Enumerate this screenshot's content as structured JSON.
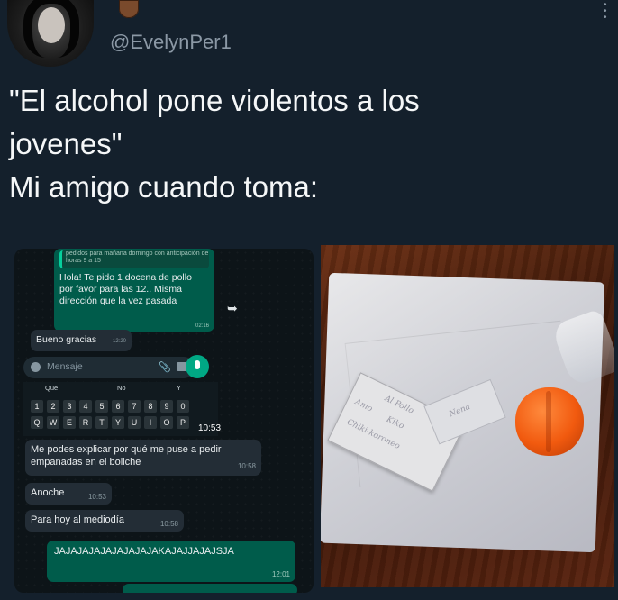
{
  "tweet": {
    "handle": "@EvelynPer1",
    "text_lines": [
      "\"El alcohol pone violentos a los",
      "jovenes\"",
      "Mi amigo cuando toma:"
    ]
  },
  "whatsapp": {
    "quoted_text": "pedidos para mañana domingo con anticipación de horas 9 a 15",
    "msg1_text": "Hola! Te pido 1 docena de pollo por favor para las 12.. Misma dirección que la vez pasada",
    "msg1_time": "02:16",
    "msg2_text": "Bueno gracias",
    "msg2_time": "12:20",
    "input_placeholder": "Mensaje",
    "keyboard_suggestions": [
      "Que",
      "No",
      "Y"
    ],
    "keyboard_keys": [
      "1",
      "2",
      "3",
      "4",
      "5",
      "6",
      "7",
      "8",
      "9",
      "0"
    ],
    "keyboard_letters": [
      "Q",
      "W",
      "E",
      "R",
      "T",
      "Y",
      "U",
      "I",
      "O",
      "P"
    ],
    "clock": "10:53",
    "chat": [
      {
        "text": "Me podes explicar por qué me puse a pedir empanadas en el boliche",
        "time": "10:58"
      },
      {
        "text": "Anoche",
        "time": "10:53"
      },
      {
        "text": "Para hoy al mediodía",
        "time": "10:58"
      }
    ],
    "reply_text": "JAJAJAJAJAJAJAJAJAKAJAJJAJAJSJA",
    "reply_time": "12:01"
  },
  "photo": {
    "card_lines": [
      "Al Pollo",
      "Amo",
      "Kiko",
      "Chiki-koroneo"
    ],
    "tag_text": "Nena"
  },
  "colors": {
    "background": "#14202c",
    "wa_outgoing": "#005c4b",
    "wa_incoming": "#232d36",
    "wa_accent": "#00a884"
  },
  "icons": [
    "more-icon",
    "share-icon",
    "emoji-icon",
    "attach-icon",
    "camera-icon",
    "mic-icon"
  ]
}
